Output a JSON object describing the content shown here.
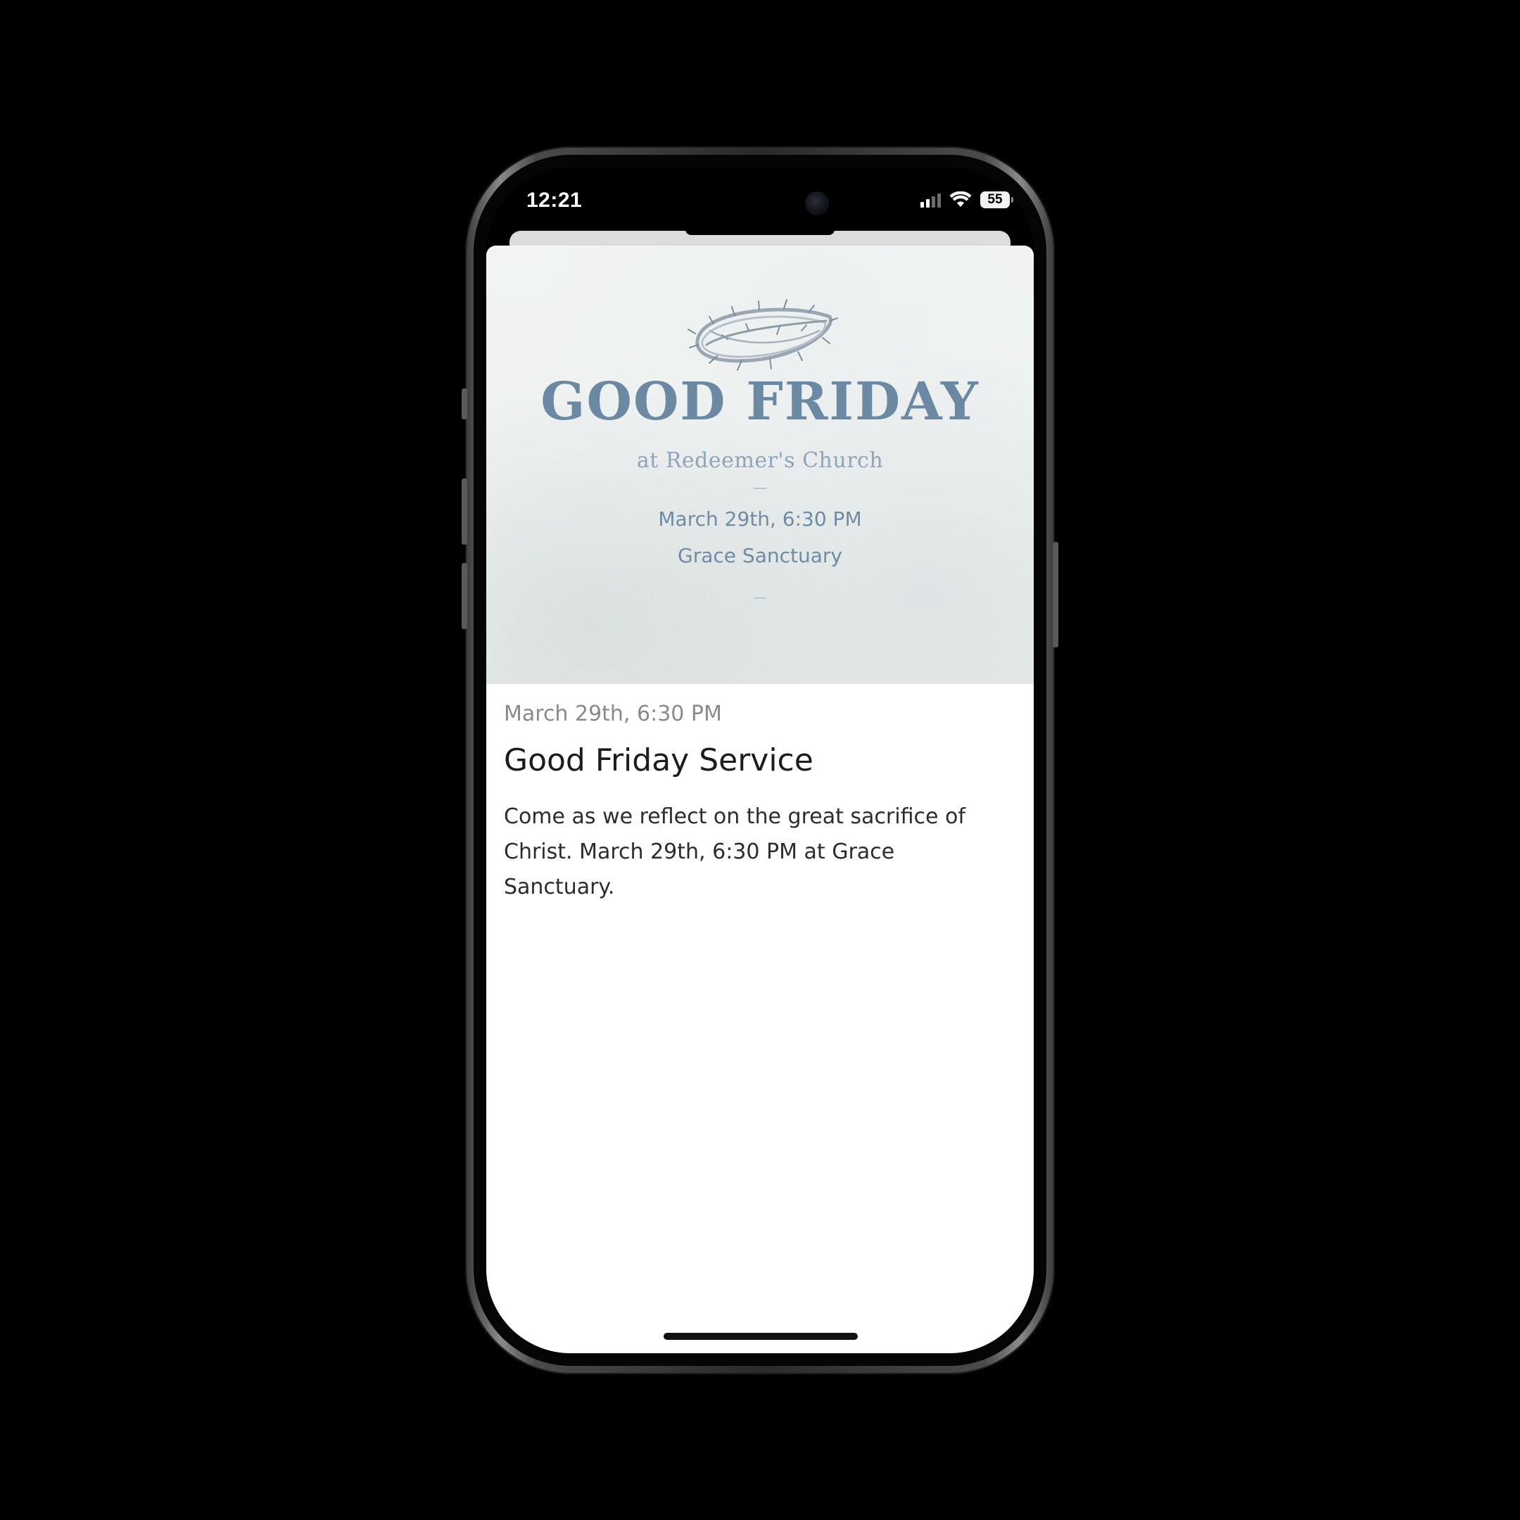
{
  "status_bar": {
    "time": "12:21",
    "battery_level": "55",
    "signal_bars": 4,
    "signal_active": 2,
    "icons": [
      "signal-icon",
      "wifi-icon",
      "battery-icon"
    ]
  },
  "banner": {
    "title": "GOOD FRIDAY",
    "subtitle": "at Redeemer's Church",
    "date": "March 29th, 6:30 PM",
    "venue": "Grace Sanctuary",
    "icon": "crown-of-thorns-icon"
  },
  "event": {
    "date": "March 29th, 6:30 PM",
    "title": "Good Friday Service",
    "description": "Come as we reflect on the great sacrifice of Christ. March 29th, 6:30 PM at Grace Sanctuary."
  },
  "colors": {
    "banner_text": "#6c89a3",
    "background": "#000000",
    "sheet": "#ffffff"
  }
}
